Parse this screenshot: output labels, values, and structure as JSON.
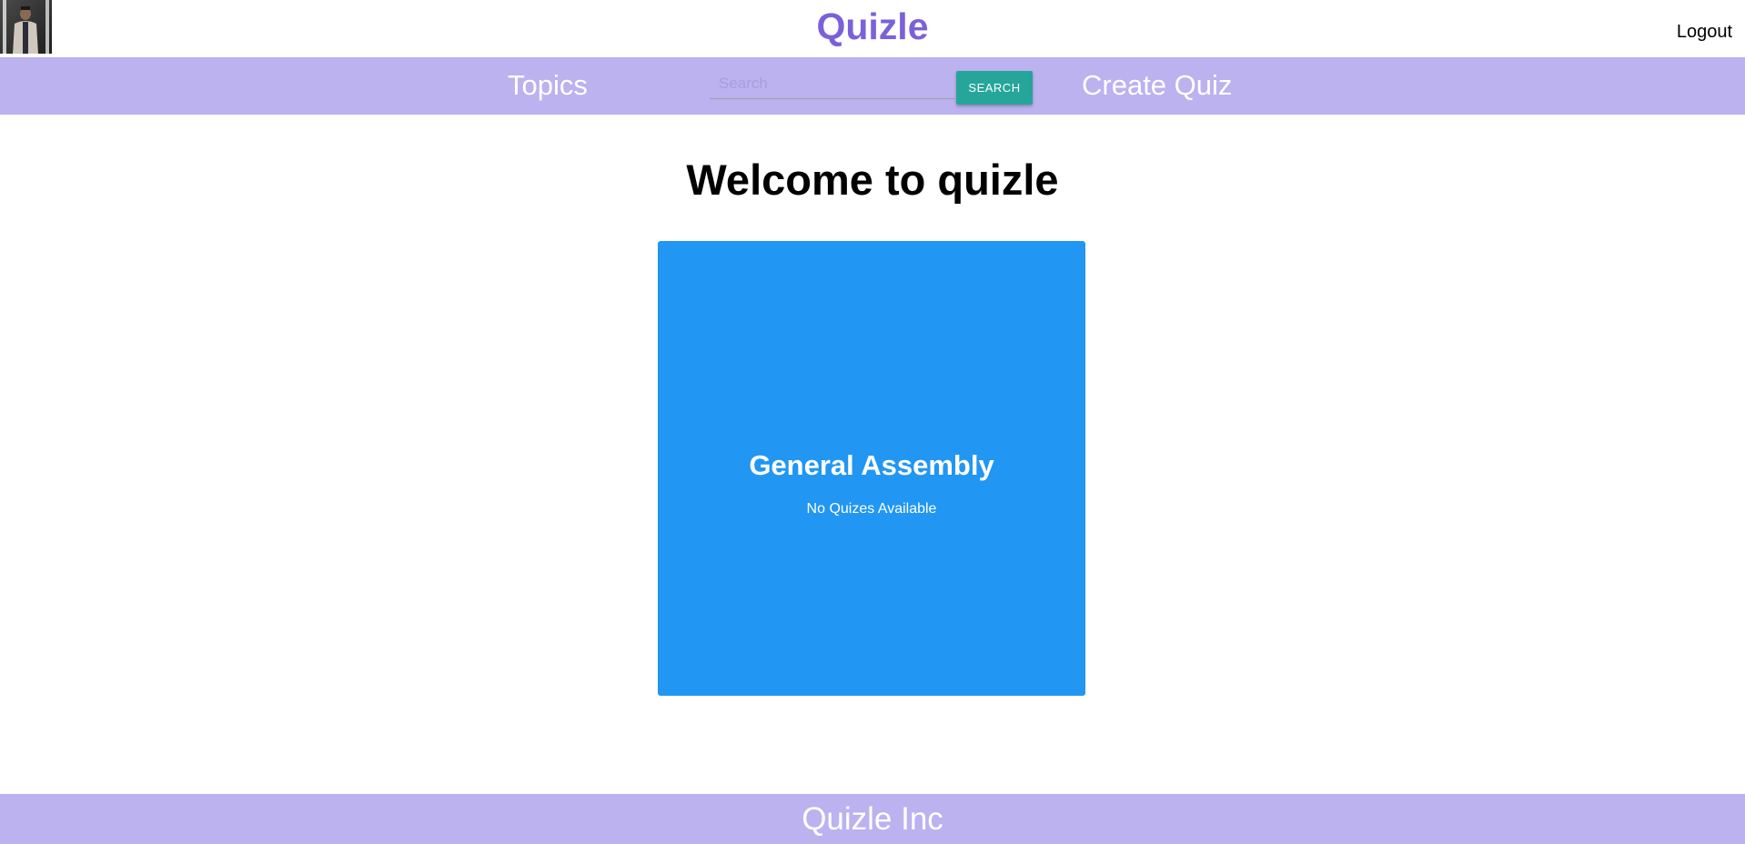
{
  "header": {
    "brand": "Quizle",
    "logout_label": "Logout"
  },
  "nav": {
    "topics_label": "Topics",
    "search_placeholder": "Search",
    "search_value": "",
    "search_button_label": "SEARCH",
    "create_quiz_label": "Create Quiz"
  },
  "main": {
    "welcome": "Welcome to quizle",
    "topics": [
      {
        "name": "General Assembly",
        "status": "No Quizes Available",
        "color": "#2196f3"
      }
    ]
  },
  "footer": {
    "text": "Quizle Inc"
  },
  "colors": {
    "brand": "#7b61d9",
    "navbar": "#bbb2ef",
    "search_button": "#26a69a",
    "card": "#2196f3"
  }
}
